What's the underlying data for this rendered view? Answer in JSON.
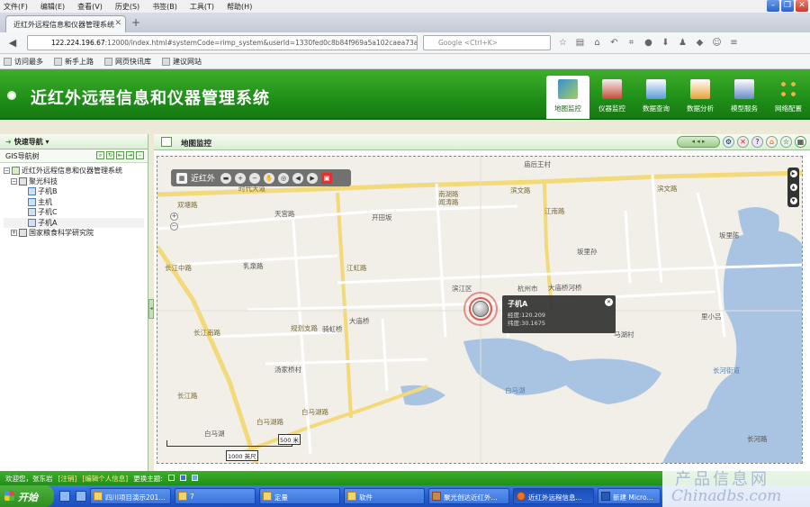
{
  "browser": {
    "menu": [
      "文件(F)",
      "编辑(E)",
      "查看(V)",
      "历史(S)",
      "书签(B)",
      "工具(T)",
      "帮助(H)"
    ],
    "tab_title": "近红外远程信息和仪器管理系统",
    "url_host": "122.224.196.67",
    "url_rest": ":12000/index.html#systemCode=rimp_system&userId=1330fed0c8b84f969a5a102caea73a60",
    "search_placeholder": "Google <Ctrl+K>",
    "bookmarks": [
      "访问最多",
      "新手上路",
      "网页快讯库",
      "建议网站"
    ]
  },
  "app": {
    "title": "近红外远程信息和仪器管理系统",
    "modules": [
      {
        "label": "地图监控",
        "icon": "map-monitor-icon",
        "active": true
      },
      {
        "label": "仪器监控",
        "icon": "instrument-monitor-icon"
      },
      {
        "label": "数据查询",
        "icon": "data-query-icon"
      },
      {
        "label": "数据分析",
        "icon": "data-analysis-icon"
      },
      {
        "label": "模型服务",
        "icon": "model-service-icon"
      },
      {
        "label": "网络配置",
        "icon": "network-config-icon"
      }
    ],
    "colors": {
      "brand_green": "#1f8f19",
      "accent": "#3fae2b"
    }
  },
  "left": {
    "quick_nav": "快速导航",
    "gis_tree_label": "GIS导航树",
    "tree": [
      {
        "label": "近红外远程信息和仪器管理系统",
        "level": 0,
        "type": "root"
      },
      {
        "label": "聚光科技",
        "level": 1,
        "type": "org"
      },
      {
        "label": "子机B",
        "level": 2,
        "type": "device"
      },
      {
        "label": "主机",
        "level": 2,
        "type": "device"
      },
      {
        "label": "子机C",
        "level": 2,
        "type": "device"
      },
      {
        "label": "子机A",
        "level": 2,
        "type": "device",
        "selected": true
      },
      {
        "label": "国家粮食科学研究院",
        "level": 1,
        "type": "org"
      }
    ]
  },
  "main": {
    "title": "地图监控",
    "map_toolbar_label": "近红外",
    "labels": {
      "l1": "双塘路",
      "l2": "天宫路",
      "l3": "开田坂",
      "l4": "庙后王村",
      "l5": "滨文路",
      "l6": "滨文路",
      "l7": "南湖路",
      "l8": "坂里孙",
      "l9": "坂里陈",
      "l10": "乳泉路",
      "l11": "长江中路",
      "l12": "时代大道",
      "l13": "江虹路",
      "l14": "滨江区",
      "l15": "杭州市",
      "l16": "大庙桥河桥",
      "l17": "江南路",
      "l18": "里小吕",
      "l19": "规划支路",
      "l20": "大庙桥",
      "l21": "骑虹桥",
      "l22": "马湖村",
      "l23": "长江南路",
      "l24": "汤家桥村",
      "l25": "长河街道",
      "l26": "白马湖",
      "l27": "白马湖路",
      "l28": "长江路",
      "l29": "白马湖路",
      "l30": "白马湖",
      "l31": "长河路",
      "l32": "闻涛路"
    },
    "popup": {
      "title": "子机A",
      "lng": "经度:120.209",
      "lat": "纬度:30.1675"
    },
    "scale": {
      "top": "500 米",
      "bottom": "1000 英尺"
    }
  },
  "status": {
    "welcome": "欢迎您，张东岩",
    "logout": "[注销]",
    "edit_info": "[编辑个人信息]",
    "theme_label": "更换主题:"
  },
  "taskbar": {
    "start": "开始",
    "items": [
      "四川项目演示201...",
      "7",
      "定量",
      "软件",
      "聚光创达近红外...",
      "近红外远程信息...",
      "新建 Micro..."
    ]
  },
  "watermark": {
    "cn": "产品信息网",
    "en": "Chinadbs.com"
  }
}
